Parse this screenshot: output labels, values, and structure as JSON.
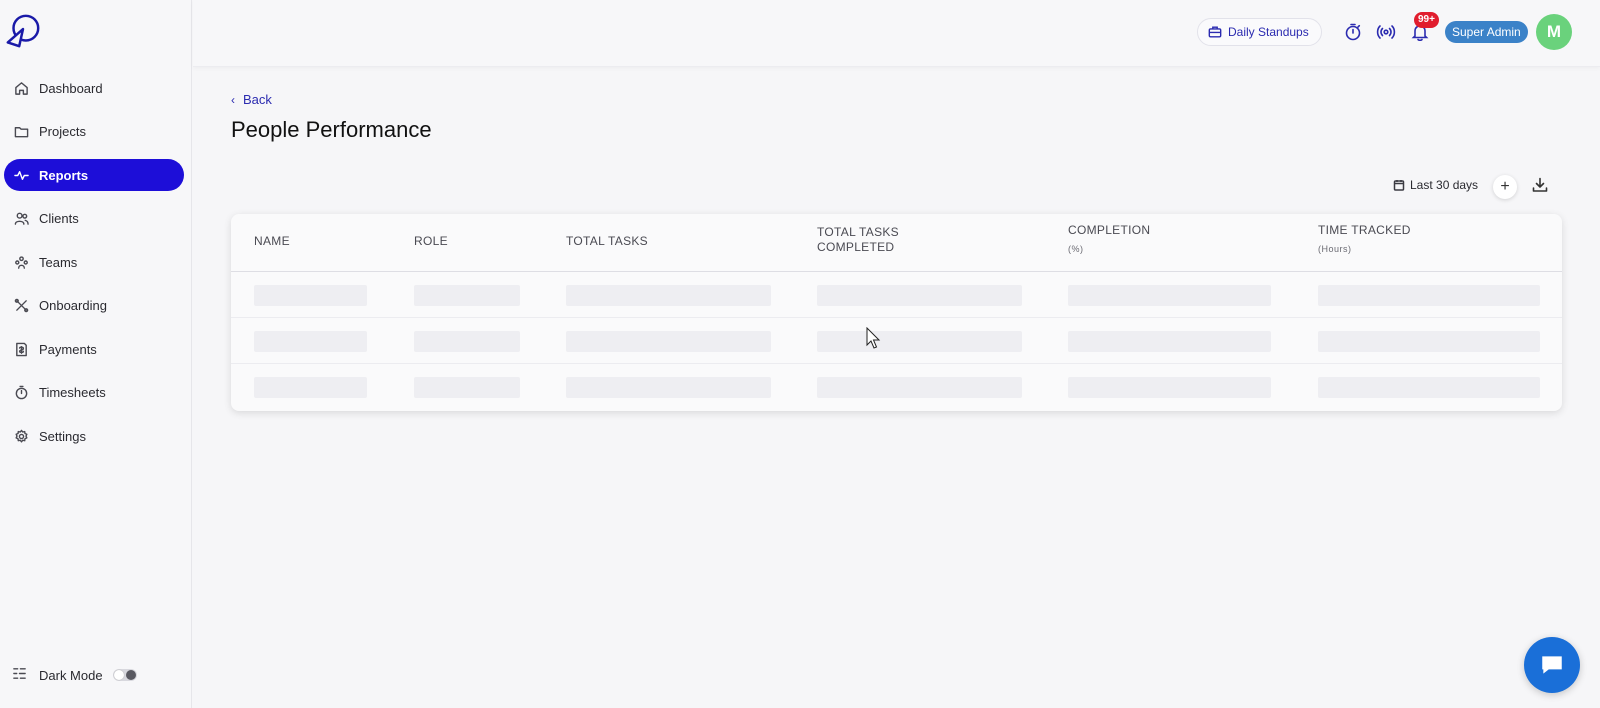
{
  "sidebar": {
    "items": [
      {
        "label": "Dashboard",
        "icon": "home-icon"
      },
      {
        "label": "Projects",
        "icon": "folder-icon"
      },
      {
        "label": "Reports",
        "icon": "activity-icon",
        "active": true
      },
      {
        "label": "Clients",
        "icon": "users-icon"
      },
      {
        "label": "Teams",
        "icon": "team-icon"
      },
      {
        "label": "Onboarding",
        "icon": "tools-icon"
      },
      {
        "label": "Payments",
        "icon": "invoice-icon"
      },
      {
        "label": "Timesheets",
        "icon": "stopwatch-icon"
      },
      {
        "label": "Settings",
        "icon": "gear-icon"
      }
    ],
    "dark_mode_label": "Dark Mode",
    "dark_mode_on": false
  },
  "topbar": {
    "standup_label": "Daily Standups",
    "notification_count": "99+",
    "role_label": "Super Admin",
    "avatar_initial": "M"
  },
  "main": {
    "back_label": "Back",
    "title": "People Performance",
    "date_range": "Last 30 days",
    "add_label": "+",
    "table": {
      "columns": [
        {
          "label": "NAME",
          "sub": ""
        },
        {
          "label": "ROLE",
          "sub": ""
        },
        {
          "label": "TOTAL TASKS",
          "sub": ""
        },
        {
          "label": "TOTAL TASKS COMPLETED",
          "sub": ""
        },
        {
          "label": "COMPLETION",
          "sub": "(%)"
        },
        {
          "label": "TIME TRACKED",
          "sub": "(Hours)"
        }
      ],
      "loading_rows": 3
    }
  },
  "colors": {
    "accent": "#1d0ed8",
    "badge": "#e11d2e",
    "role_pill": "#3b82c8",
    "avatar": "#6ad27c",
    "chat": "#1a6fd8"
  }
}
